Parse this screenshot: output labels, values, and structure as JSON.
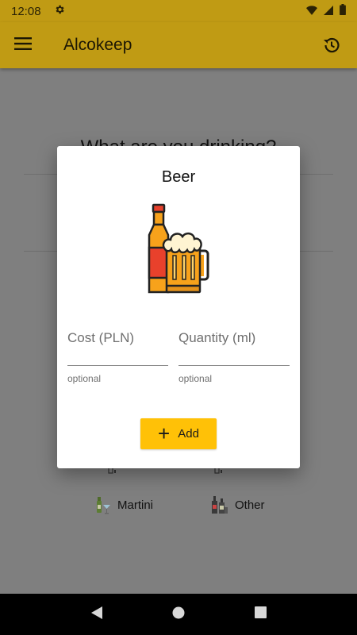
{
  "status_bar": {
    "time": "12:08"
  },
  "app_bar": {
    "title": "Alcokeep"
  },
  "background": {
    "heading": "What are you drinking?",
    "drinks": [
      {
        "label": "Martini",
        "icon": "martini-icon"
      },
      {
        "label": "Other",
        "icon": "bottles-icon"
      }
    ]
  },
  "dialog": {
    "title": "Beer",
    "illustration": "beer-bottle-and-mug-icon",
    "cost": {
      "label": "Cost (PLN)",
      "helper": "optional",
      "value": ""
    },
    "quantity": {
      "label": "Quantity (ml)",
      "helper": "optional",
      "value": ""
    },
    "add_button": {
      "label": "Add"
    }
  },
  "colors": {
    "accent": "#ffc107",
    "app_bar_dimmed": "#c09b14",
    "scrim": "#7f7f7f"
  }
}
